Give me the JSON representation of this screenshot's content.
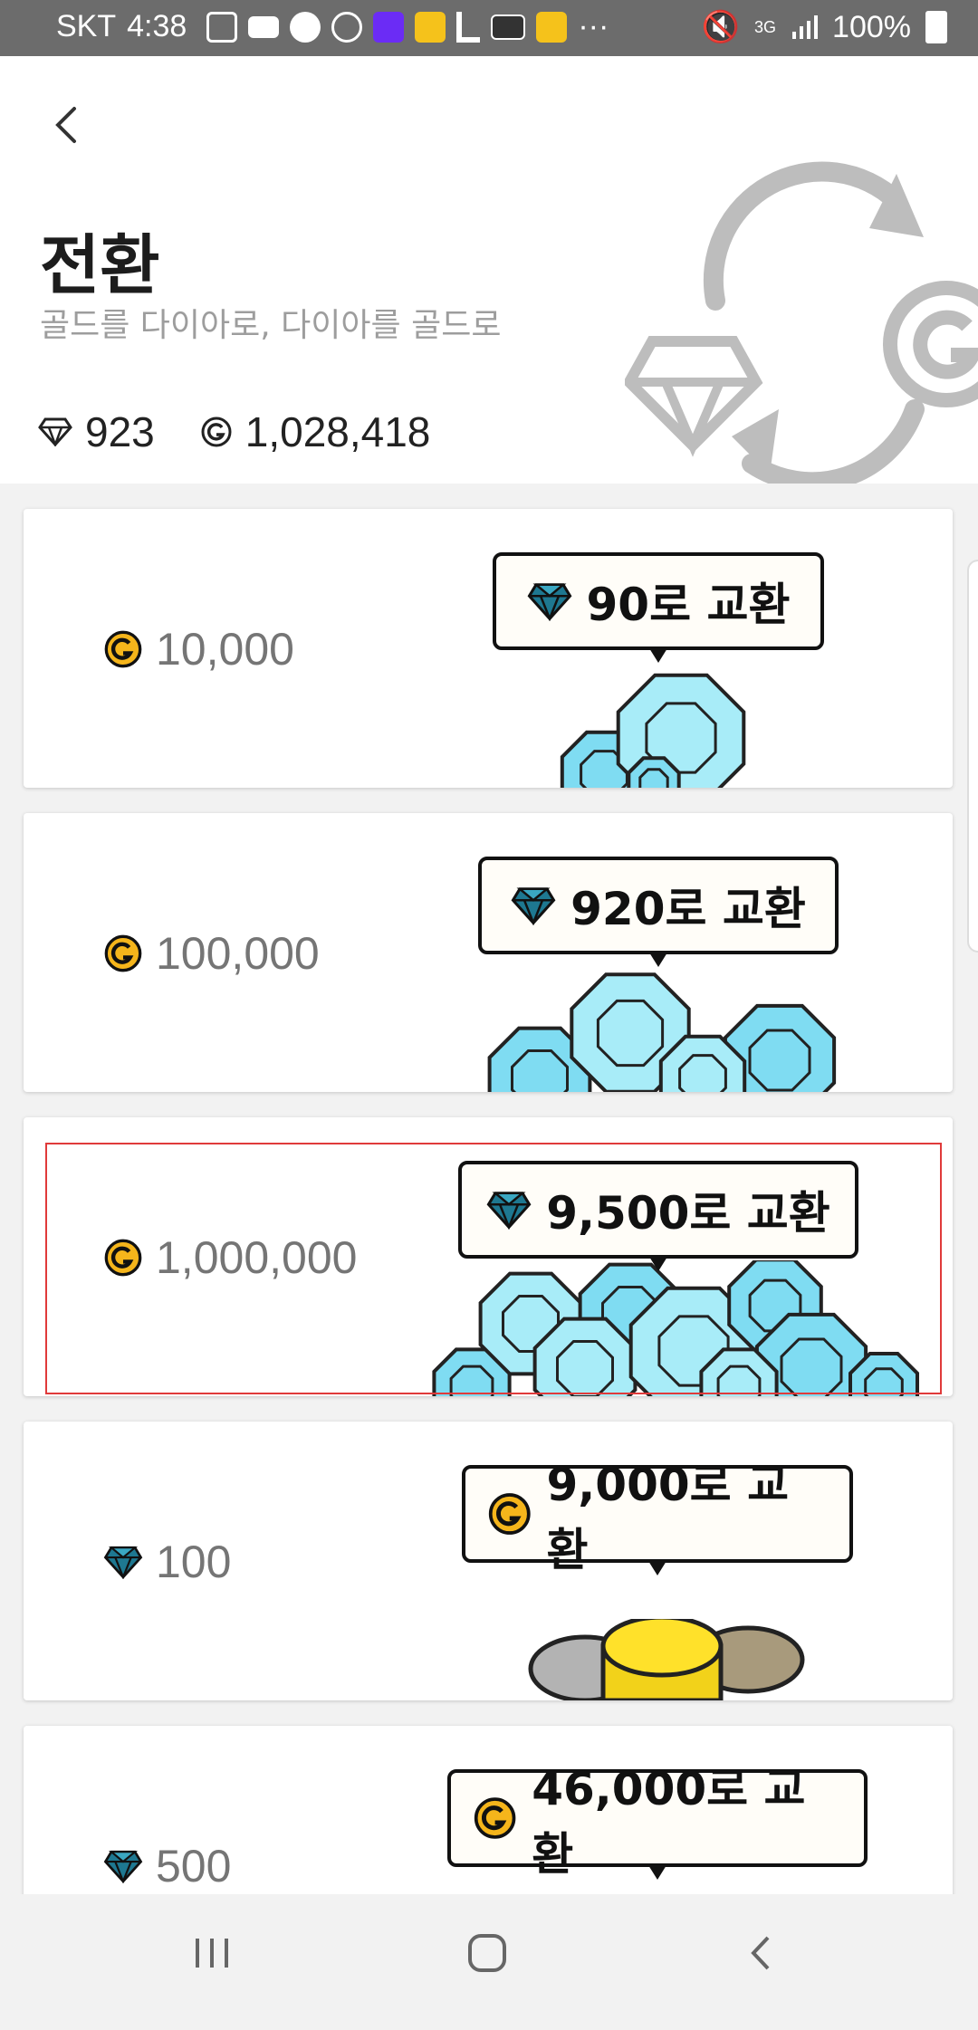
{
  "status_bar": {
    "carrier": "SKT",
    "time": "4:38",
    "network": "3G",
    "battery": "100%"
  },
  "header": {
    "title": "전환",
    "subtitle": "골드를 다이아로, 다이아를 골드로",
    "diamond_balance": "923",
    "gold_balance": "1,028,418"
  },
  "colors": {
    "gold": "#f5b51b",
    "diamond": "#7fdcf2",
    "diamond_dark": "#1d6f85",
    "selection": "#e03a3a",
    "art_gray": "#bdbdbd"
  },
  "offers": [
    {
      "from_icon": "gold-coin-icon",
      "amount": "10,000",
      "to_icon": "diamond-icon",
      "exchange_label": "90로 교환"
    },
    {
      "from_icon": "gold-coin-icon",
      "amount": "100,000",
      "to_icon": "diamond-icon",
      "exchange_label": "920로 교환"
    },
    {
      "from_icon": "gold-coin-icon",
      "amount": "1,000,000",
      "to_icon": "diamond-icon",
      "exchange_label": "9,500로 교환",
      "selected": true
    },
    {
      "from_icon": "diamond-icon",
      "amount": "100",
      "to_icon": "gold-coin-icon",
      "exchange_label": "9,000로 교환"
    },
    {
      "from_icon": "diamond-icon",
      "amount": "500",
      "to_icon": "gold-coin-icon",
      "exchange_label": "46,000로 교환"
    }
  ]
}
